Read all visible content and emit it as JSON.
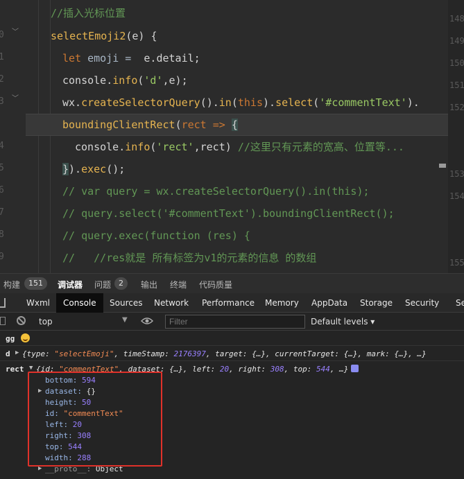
{
  "editor": {
    "line_numbers": [
      "0",
      "1",
      "2",
      "3",
      "4",
      "5",
      "6",
      "7",
      "8",
      "9"
    ],
    "right_line_numbers": [
      "148",
      "149",
      "150",
      "151",
      "152",
      "153",
      "154",
      "155"
    ],
    "lines": {
      "l0": "//插入光标位置",
      "l1_fn": "selectEmoji2",
      "l1_rest": "(e) {",
      "l2_kw": "let",
      "l2_var": " emoji = ",
      "l2_rest": " e.detail;",
      "l3_a": "console.",
      "l3_fn": "info",
      "l3_b": "(",
      "l3_str": "'d'",
      "l3_c": ",e);",
      "l4_a": "wx.",
      "l4_fn1": "createSelectorQuery",
      "l4_b": "().",
      "l4_fn2": "in",
      "l4_c": "(",
      "l4_kw": "this",
      "l4_d": ").",
      "l4_fn3": "select",
      "l4_e": "(",
      "l4_str": "'#commentText'",
      "l4_f": ").",
      "l5_fn": "boundingClientRect",
      "l5_a": "(",
      "l5_b": "rect => ",
      "l5_brace": "{",
      "l6_a": "console.",
      "l6_fn": "info",
      "l6_b": "(",
      "l6_str": "'rect'",
      "l6_c": ",rect) ",
      "l6_com": "//这里只有元素的宽高、位置等...",
      "l7_brace": "}",
      "l7_a": ").",
      "l7_fn": "exec",
      "l7_b": "();",
      "l8": "// var query = wx.createSelectorQuery().in(this);",
      "l9": "// query.select('#commentText').boundingClientRect();",
      "l10": "// query.exec(function (res) {",
      "l11": "//   //res就是 所有标签为v1的元素的信息 的数组"
    }
  },
  "panel_tabs": {
    "build": "构建",
    "build_count": "151",
    "debugger": "调试器",
    "issues": "问题",
    "issues_count": "2",
    "output": "输出",
    "terminal": "终端",
    "quality": "代码质量"
  },
  "dev_tabs": [
    "Wxml",
    "Console",
    "Sources",
    "Network",
    "Performance",
    "Memory",
    "AppData",
    "Storage",
    "Security",
    "Se"
  ],
  "toolbar": {
    "context": "top",
    "filter_placeholder": "Filter",
    "levels": "Default levels ▾"
  },
  "console": {
    "gg_label": "gg",
    "d_label": "d",
    "d_obj": "{type: ",
    "d_type": "\"selectEmoji\"",
    "d_rest1": ", timeStamp: ",
    "d_ts": "2176397",
    "d_rest2": ", target: {…}, currentTarget: {…}, mark: {…}, …}",
    "rect_label": "rect",
    "rect_obj": "{id: ",
    "rect_id": "\"commentText\"",
    "rect_r1": ", dataset: {…}, left: ",
    "rect_left": "20",
    "rect_r2": ", right: ",
    "rect_right": "308",
    "rect_r3": ", top: ",
    "rect_top": "544",
    "rect_r4": ", …}",
    "props": [
      {
        "key": "bottom",
        "value": "594",
        "kind": "num"
      },
      {
        "key": "dataset",
        "value": "{}",
        "kind": "obj"
      },
      {
        "key": "height",
        "value": "50",
        "kind": "num"
      },
      {
        "key": "id",
        "value": "\"commentText\"",
        "kind": "str"
      },
      {
        "key": "left",
        "value": "20",
        "kind": "num"
      },
      {
        "key": "right",
        "value": "308",
        "kind": "num"
      },
      {
        "key": "top",
        "value": "544",
        "kind": "num"
      },
      {
        "key": "width",
        "value": "288",
        "kind": "num"
      }
    ],
    "proto_key": "__proto__",
    "proto_val": "Object"
  },
  "colors": {
    "highlight_box": "#e0312a",
    "active_tab_bg": "#0d0d0d",
    "number": "#9980ff",
    "string": "#f28b54"
  }
}
